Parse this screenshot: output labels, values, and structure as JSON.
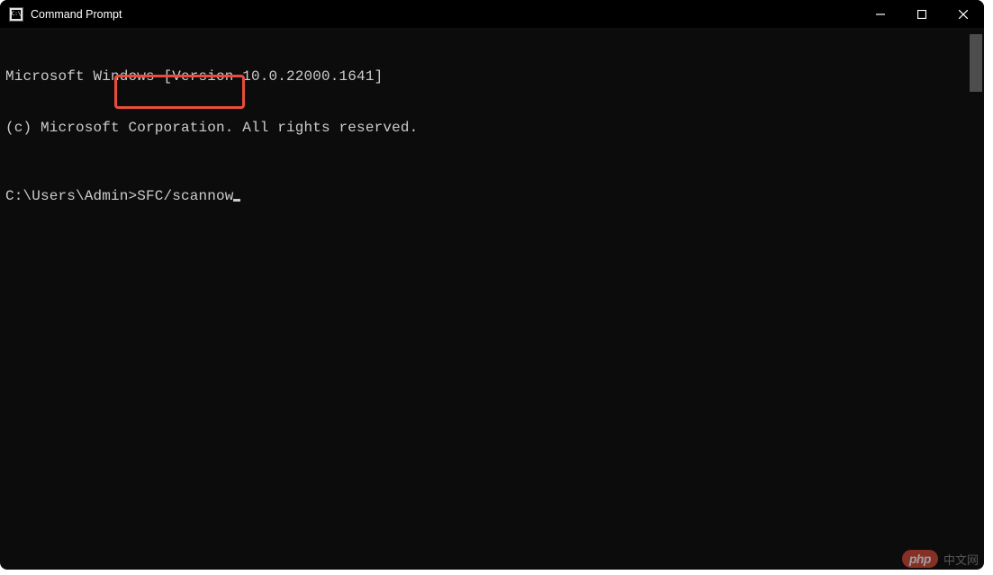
{
  "window": {
    "title": "Command Prompt"
  },
  "terminal": {
    "line1": "Microsoft Windows [Version 10.0.22000.1641]",
    "line2": "(c) Microsoft Corporation. All rights reserved.",
    "prompt": "C:\\Users\\Admin>",
    "command": "SFC/scannow"
  },
  "watermark": {
    "badge": "php",
    "text": "中文网"
  }
}
